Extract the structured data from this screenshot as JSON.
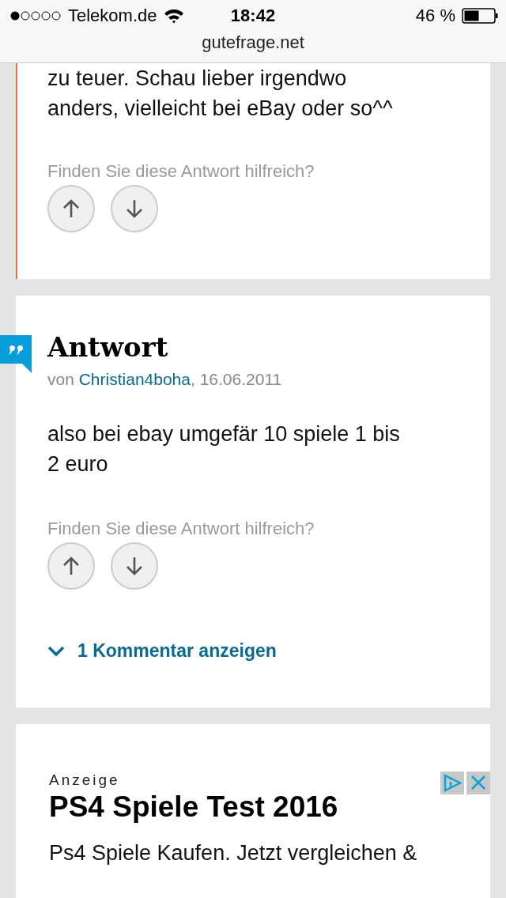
{
  "status_bar": {
    "carrier": "Telekom.de",
    "time": "18:42",
    "battery": "46 %"
  },
  "url": "gutefrage.net",
  "answers": [
    {
      "kind": "partial",
      "highlighted": true,
      "body": "zu teuer. Schau lieber irgendwo anders, vielleicht bei eBay oder so^^",
      "helpful_prompt": "Finden Sie diese Antwort hilfreich?"
    },
    {
      "kind": "full",
      "highlighted": false,
      "title": "Antwort",
      "by": "von",
      "author": "Christian4boha",
      "date": ", 16.06.2011",
      "body": "also bei ebay umgefär 10 spiele 1 bis 2 euro",
      "helpful_prompt": "Finden Sie diese Antwort hilfreich?",
      "comments_link": "1 Kommentar anzeigen"
    }
  ],
  "ad": {
    "label": "Anzeige",
    "title": "PS4 Spiele Test 2016",
    "text": "Ps4 Spiele Kaufen. Jetzt vergleichen &"
  }
}
